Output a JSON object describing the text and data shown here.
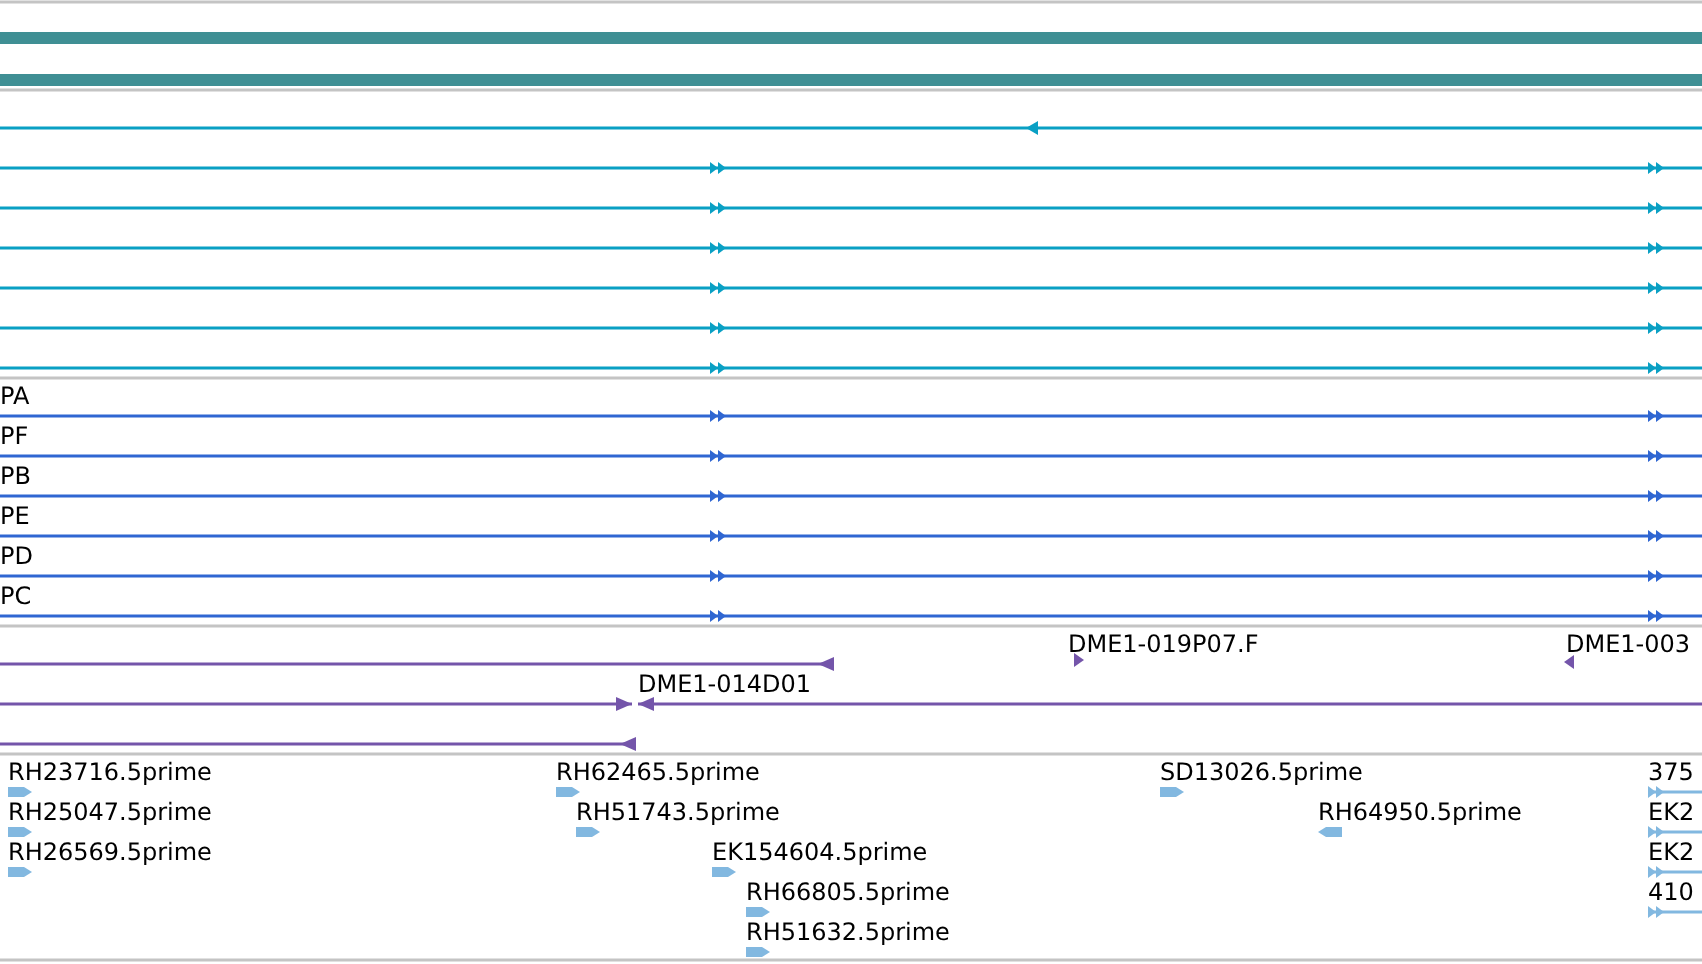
{
  "tracks": [
    {
      "kind": "transcripts",
      "color": "#0aa0c4",
      "items": [
        {
          "reverse": true
        },
        {
          "reverse": false
        },
        {
          "reverse": false
        },
        {
          "reverse": false
        },
        {
          "reverse": false
        },
        {
          "reverse": false
        },
        {
          "reverse": false
        }
      ]
    },
    {
      "kind": "transcripts",
      "color": "#2f66d2",
      "items": [
        {
          "label": "PA",
          "reverse": false
        },
        {
          "label": "PF",
          "reverse": false
        },
        {
          "label": "PB",
          "reverse": false
        },
        {
          "label": "PE",
          "reverse": false
        },
        {
          "label": "PD",
          "reverse": false
        },
        {
          "label": "PC",
          "reverse": false
        }
      ]
    },
    {
      "kind": "clones",
      "color": "#7455aa",
      "items": [
        {
          "reverse": true
        },
        {
          "label": "DME1-019P07.F",
          "reverse": false
        },
        {
          "label": "DME1-003",
          "reverse": true
        },
        {
          "reverse": false
        },
        {
          "label": "DME1-014D01",
          "reverse": true
        },
        {
          "reverse": true
        }
      ]
    },
    {
      "kind": "ests",
      "color": "#82b8e0",
      "items": [
        {
          "label": "RH23716.5prime",
          "reverse": false
        },
        {
          "label": "RH25047.5prime",
          "reverse": false
        },
        {
          "label": "RH26569.5prime",
          "reverse": false
        },
        {
          "label": "RH62465.5prime",
          "reverse": false
        },
        {
          "label": "RH51743.5prime",
          "reverse": false
        },
        {
          "label": "EK154604.5prime",
          "reverse": false
        },
        {
          "label": "RH66805.5prime",
          "reverse": false
        },
        {
          "label": "RH51632.5prime",
          "reverse": false
        },
        {
          "label": "SD13026.5prime",
          "reverse": false
        },
        {
          "label": "RH64950.5prime",
          "reverse": true
        },
        {
          "label": "375",
          "reverse": false
        },
        {
          "label": "EK2",
          "reverse": false
        },
        {
          "label": "EK2",
          "reverse": false
        },
        {
          "label": "410",
          "reverse": false
        }
      ]
    }
  ]
}
